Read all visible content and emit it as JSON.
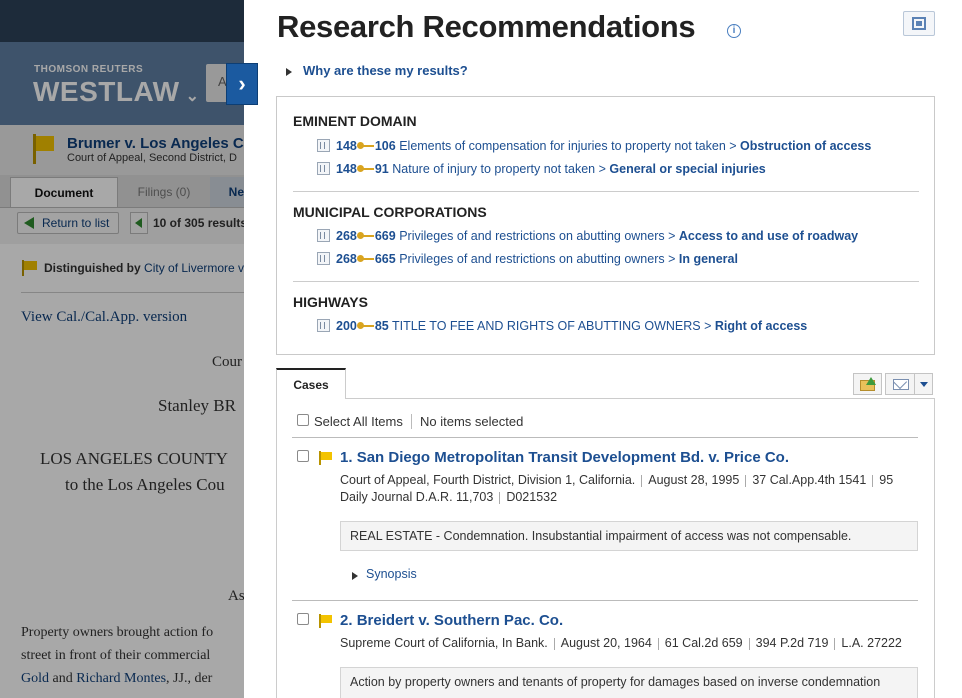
{
  "background": {
    "brand": {
      "company": "THOMSON REUTERS",
      "product": "WESTLAW",
      "caret": "⌄",
      "search_partial": "A"
    },
    "case": {
      "title": "Brumer v. Los Angeles Co",
      "court": "Court of Appeal, Second District, D"
    },
    "tabs": {
      "document": "Document",
      "filings": "Filings (0)",
      "negative": "Neg"
    },
    "nav": {
      "return_label": "Return to list",
      "count": "10 of 305 results"
    },
    "distinguished": {
      "label": "Distinguished by",
      "link": "City of Livermore v."
    },
    "view_version": "View Cal./Cal.App. version",
    "text": {
      "court_partial": "Cour",
      "party1": "Stanley BR",
      "party2": "LOS ANGELES COUNTY",
      "party3": "to the Los Angeles Cou",
      "as": "As",
      "body1": "Property owners brought action fo",
      "body2": "street in front of their commercial",
      "body3_link1": "Gold",
      "body3_and": "and",
      "body3_link2": "Richard Montes",
      "body3_rest": ", JJ., der"
    }
  },
  "panel": {
    "title": "Research Recommendations",
    "info_icon": "i",
    "why_label": "Why are these my results?",
    "key_sections": [
      {
        "heading": "EMINENT DOMAIN",
        "rows": [
          {
            "topic": "148",
            "sub": "106",
            "desc": "Elements of compensation for injuries to property not taken >",
            "target": "Obstruction of access"
          },
          {
            "topic": "148",
            "sub": "91",
            "desc": "Nature of injury to property not taken >",
            "target": "General or special injuries"
          }
        ]
      },
      {
        "heading": "MUNICIPAL CORPORATIONS",
        "rows": [
          {
            "topic": "268",
            "sub": "669",
            "desc": "Privileges of and restrictions on abutting owners >",
            "target": "Access to and use of roadway"
          },
          {
            "topic": "268",
            "sub": "665",
            "desc": "Privileges of and restrictions on abutting owners >",
            "target": "In general"
          }
        ]
      },
      {
        "heading": "HIGHWAYS",
        "rows": [
          {
            "topic": "200",
            "sub": "85",
            "desc": "TITLE TO FEE AND RIGHTS OF ABUTTING OWNERS >",
            "target": "Right of access"
          }
        ]
      }
    ],
    "cases_tab": "Cases",
    "select_all": "Select All Items",
    "no_items": "No items selected",
    "results": [
      {
        "num": "1.",
        "title": "San Diego Metropolitan Transit Development Bd. v. Price Co.",
        "court": "Court of Appeal, Fourth District, Division 1, California.",
        "date": "August 28, 1995",
        "cite1": "37 Cal.App.4th 1541",
        "cite2": "95",
        "cite3": "Daily Journal D.A.R. 11,703",
        "cite4": "D021532",
        "summary": "REAL ESTATE - Condemnation. Insubstantial impairment of access was not compensable.",
        "synopsis": "Synopsis"
      },
      {
        "num": "2.",
        "title": "Breidert v. Southern Pac. Co.",
        "court": "Supreme Court of California, In Bank.",
        "date": "August 20, 1964",
        "cite1": "61 Cal.2d 659",
        "cite2": "394 P.2d 719",
        "cite3": "L.A. 27222",
        "summary": "Action by property owners and tenants of property for damages based on inverse condemnation"
      }
    ]
  }
}
